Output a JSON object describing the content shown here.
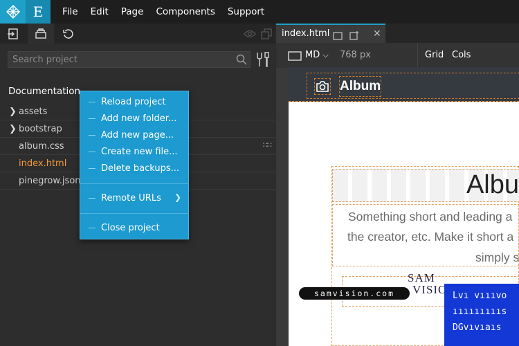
{
  "app": {
    "logo_letter": "E"
  },
  "menu": [
    "File",
    "Edit",
    "Page",
    "Components",
    "Support"
  ],
  "left_panel": {
    "search_placeholder": "Search project",
    "project_title": "Documentation",
    "files": [
      {
        "name": "assets",
        "type": "folder"
      },
      {
        "name": "bootstrap",
        "type": "folder"
      },
      {
        "name": "album.css",
        "type": "file"
      },
      {
        "name": "index.html",
        "type": "file",
        "active": true
      },
      {
        "name": "pinegrow.json",
        "type": "file"
      }
    ],
    "dots": "⋯"
  },
  "context_menu": {
    "items": [
      "Reload project",
      "Add new folder...",
      "Add new page...",
      "Create new file...",
      "Delete backups...",
      "Remote URLs",
      "Close project"
    ]
  },
  "editor": {
    "tab_label": "index.html",
    "device": "MD",
    "width": "768 px",
    "grid_label": "Grid",
    "cols_label": "Cols"
  },
  "preview": {
    "brand": "Album",
    "heading": "Albu",
    "lead_lines": [
      "Something short and leading a",
      "the creator, etc. Make it short a",
      "simply s"
    ]
  },
  "overlay": {
    "pill_text": "samvision.com",
    "logo_line1": "SAM",
    "logo_line2": "VISION",
    "blue_lines": [
      "Lvı vıııvo",
      "ıııııııııs",
      "DGvıvıaıs"
    ]
  },
  "colors": {
    "accent": "#1fa0c8",
    "active_file": "#f59a3b",
    "context_menu_bg": "#1d9ad0",
    "overlay_blue": "#1338d6"
  }
}
